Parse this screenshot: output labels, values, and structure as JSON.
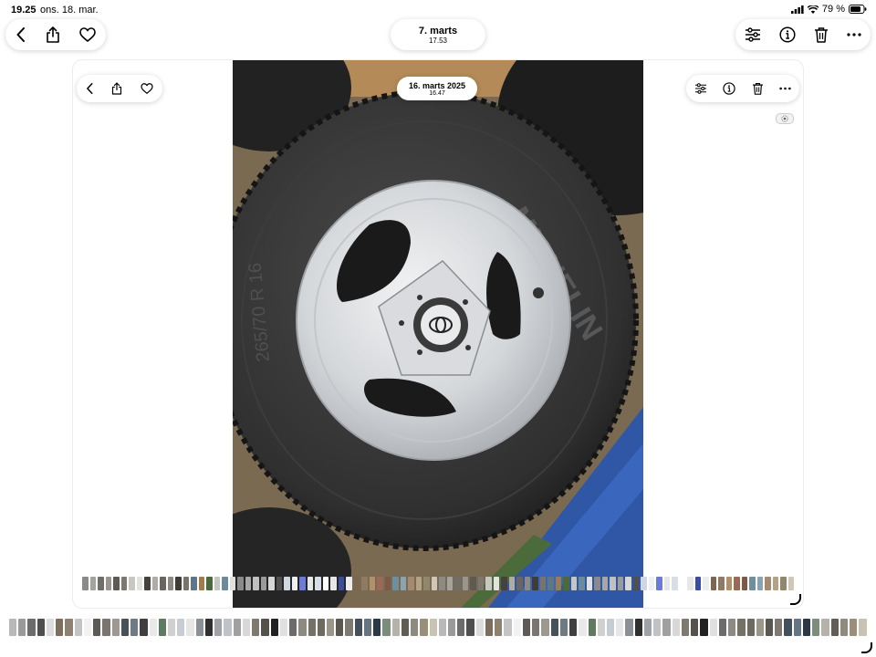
{
  "status_bar": {
    "time": "19.25",
    "date": "ons. 18. mar.",
    "battery_text": "79 %"
  },
  "outer_toolbar": {
    "title": "7. marts",
    "subtitle": "17.53"
  },
  "inner_toolbar": {
    "title": "16. marts 2025",
    "subtitle": "16.47"
  },
  "icons": [
    "back-icon",
    "share-icon",
    "heart-icon",
    "adjust-icon",
    "info-icon",
    "trash-icon",
    "more-icon",
    "live-photo-badge"
  ],
  "colors": {
    "toolbar_bg": "#ffffff",
    "accent_tire": "#2b2b2b",
    "rim": "#d6d9dc",
    "tarp": "#2f57a6"
  },
  "thumb_colors_inner": [
    "#8c8a86",
    "#a5a39d",
    "#6f6f6a",
    "#9a958d",
    "#5d5a55",
    "#7c7870",
    "#c9c7c2",
    "#e2e2e0",
    "#45413c",
    "#b0aca4",
    "#6a655e",
    "#8e8a83",
    "#3f3c38",
    "#7a736a",
    "#5f7686",
    "#9f7c4e",
    "#4a6a3a",
    "#c6c6c6",
    "#6c8b9a",
    "#e0e0e0",
    "#8a8a8a",
    "#a7a7a7",
    "#c0c0c0",
    "#9a9a9a",
    "#d7d7d7",
    "#505050",
    "#cfd8e2",
    "#f0f0f0",
    "#6c7ad8",
    "#e6e6e6",
    "#d9dde8",
    "#ffffff",
    "#e7e7e7",
    "#3b4e9e",
    "#ededed",
    "#7b6650",
    "#8f7a63",
    "#b38f6b",
    "#9b6a55",
    "#7d5a46",
    "#6f8f9f",
    "#8aa3b0",
    "#a48b70",
    "#b6a187",
    "#92866f",
    "#cfc7b8"
  ],
  "thumb_colors_outer": [
    "#b9b9b9",
    "#9a9a9a",
    "#6c6c6c",
    "#4f4f4f",
    "#dcdcdc",
    "#7c6e5f",
    "#8f8170",
    "#c4c4c4",
    "#f2f2f2",
    "#5e5a55",
    "#7a756e",
    "#9d9890",
    "#485058",
    "#6d7b86",
    "#3f3f3f",
    "#e9e9e9",
    "#5f7a5f",
    "#d0d0d0",
    "#c7ccd2",
    "#e6e6e6",
    "#8b8f96",
    "#2f2f2f",
    "#9fa3a8",
    "#bfc3c7",
    "#a0a0a0",
    "#d8d8d8",
    "#7f7a70",
    "#55514b",
    "#222222",
    "#e0e0e0",
    "#6b6b6b",
    "#8d8a82",
    "#767167",
    "#6d6a62",
    "#9c9688",
    "#5a5650",
    "#7e7a72",
    "#43505c",
    "#657584",
    "#2c3844",
    "#7d8d7d",
    "#b5b2aa",
    "#615d56",
    "#8e8a7e",
    "#9a8f7a",
    "#c9c3b3"
  ]
}
